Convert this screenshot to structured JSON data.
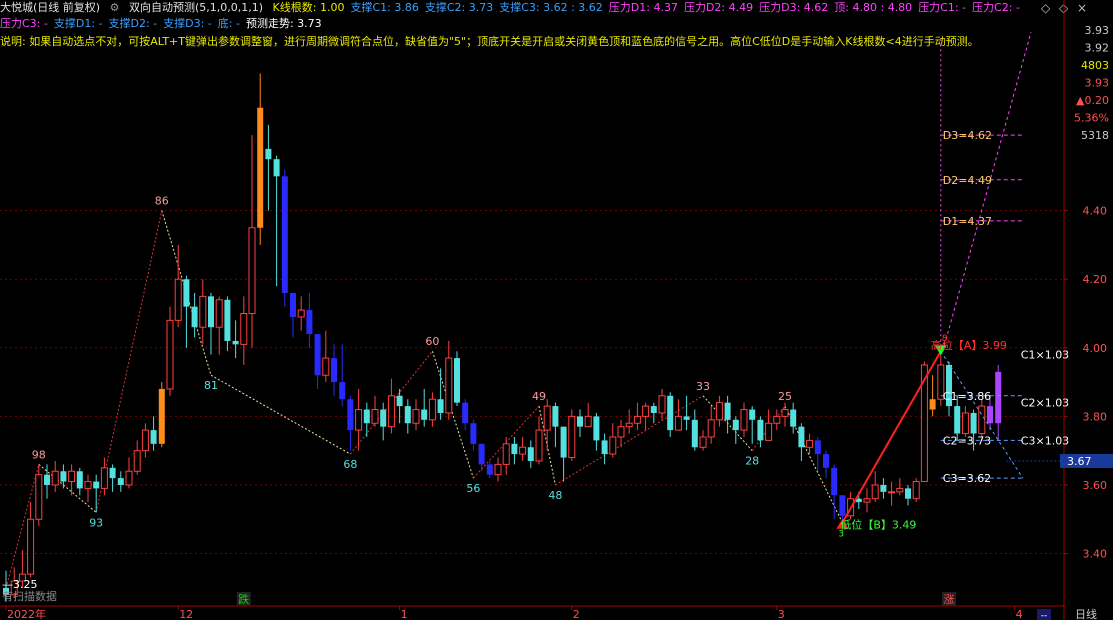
{
  "header": {
    "title": "大悦城(日线 前复权)",
    "indicator": "双向自动预测(5,1,0,0,1,1)",
    "line1": [
      {
        "label": "K线根数: 1.00",
        "color": "#e8e800"
      },
      {
        "label": "支撑C1: 3.86",
        "color": "#3aa0ff"
      },
      {
        "label": "支撑C2: 3.73",
        "color": "#3aa0ff"
      },
      {
        "label": "支撑C3: 3.62 : 3.62",
        "color": "#3aa0ff"
      },
      {
        "label": "压力D1: 4.37",
        "color": "#ff44ff"
      },
      {
        "label": "压力D2: 4.49",
        "color": "#ff44ff"
      },
      {
        "label": "压力D3: 4.62",
        "color": "#ff44ff"
      },
      {
        "label": "顶: 4.80 : 4.80",
        "color": "#ff44ff"
      },
      {
        "label": "压力C1: -",
        "color": "#ff44ff"
      },
      {
        "label": "压力C2: -",
        "color": "#ff44ff"
      }
    ],
    "line2": [
      {
        "label": "压力C3: -",
        "color": "#ff44ff"
      },
      {
        "label": "支撑D1: -",
        "color": "#3aa0ff"
      },
      {
        "label": "支撑D2: -",
        "color": "#3aa0ff"
      },
      {
        "label": "支撑D3: -",
        "color": "#3aa0ff"
      },
      {
        "label": "底: -",
        "color": "#3aa0ff"
      },
      {
        "label": "预测走势: 3.73",
        "color": "#ffffff"
      }
    ],
    "note": "说明: 如果自动选点不对，可按ALT+T键弹出参数调整窗，进行周期微调符合点位，缺省值为\"5\"；顶底开关是开启或关闭黄色顶和蓝色底的信号之用。高位C低位D是手动输入K线根数<4进行手动预测。",
    "controls": [
      "◇",
      "◇",
      "×"
    ]
  },
  "chart_data": {
    "type": "candlestick",
    "ylim": [
      3.25,
      4.95
    ],
    "yticks": [
      3.4,
      3.6,
      3.8,
      4.0,
      4.2,
      4.4
    ],
    "ytick_labels": [
      "3.40",
      "3.60",
      "3.80",
      "4.00",
      "4.20",
      "4.40"
    ],
    "xlabels": [
      {
        "label": "2022年",
        "bar": 0
      },
      {
        "label": "12",
        "bar": 21
      },
      {
        "label": "1",
        "bar": 48
      },
      {
        "label": "2",
        "bar": 69
      },
      {
        "label": "3",
        "bar": 94
      },
      {
        "label": "4",
        "bar": 123
      }
    ],
    "sidebar_values": [
      {
        "text": "3.93",
        "color": "#cccccc"
      },
      {
        "text": "3.92",
        "color": "#cccccc"
      },
      {
        "text": "4803",
        "color": "#e8e800"
      },
      {
        "text": "3.93",
        "color": "#ff5050"
      },
      {
        "text": "▲0.20",
        "color": "#ff5050"
      },
      {
        "text": "5.36%",
        "color": "#ff5050"
      },
      {
        "text": "5318",
        "color": "#cccccc"
      }
    ],
    "current_price": "3.67",
    "period_label": "日线",
    "bottom_marks": [
      {
        "text": "跌",
        "bar": 29,
        "color": "#00dd00"
      },
      {
        "text": "涨",
        "bar": 115,
        "color": "#ff5050"
      }
    ],
    "corner_text": "有扫描数据",
    "start_label": "—3.25",
    "candles": [
      [
        3.3,
        3.28,
        3.35,
        3.26
      ],
      [
        3.28,
        3.32,
        3.36,
        3.27
      ],
      [
        3.32,
        3.34,
        3.41,
        3.3
      ],
      [
        3.34,
        3.5,
        3.55,
        3.33
      ],
      [
        3.5,
        3.63,
        3.66,
        3.48
      ],
      [
        3.63,
        3.6,
        3.66,
        3.56
      ],
      [
        3.6,
        3.64,
        3.67,
        3.58
      ],
      [
        3.64,
        3.61,
        3.66,
        3.59
      ],
      [
        3.61,
        3.64,
        3.66,
        3.57
      ],
      [
        3.64,
        3.59,
        3.65,
        3.57
      ],
      [
        3.59,
        3.61,
        3.63,
        3.55
      ],
      [
        3.61,
        3.59,
        3.63,
        3.52
      ],
      [
        3.59,
        3.65,
        3.68,
        3.57
      ],
      [
        3.65,
        3.62,
        3.66,
        3.58
      ],
      [
        3.62,
        3.6,
        3.64,
        3.58
      ],
      [
        3.6,
        3.64,
        3.68,
        3.59
      ],
      [
        3.64,
        3.7,
        3.73,
        3.63
      ],
      [
        3.7,
        3.76,
        3.78,
        3.68
      ],
      [
        3.76,
        3.72,
        3.8,
        3.7
      ],
      [
        3.72,
        3.88,
        3.9,
        3.71
      ],
      [
        3.88,
        4.08,
        4.12,
        3.86
      ],
      [
        4.08,
        4.2,
        4.3,
        4.06
      ],
      [
        4.2,
        4.12,
        4.21,
        4.0
      ],
      [
        4.12,
        4.06,
        4.16,
        4.03
      ],
      [
        4.06,
        4.15,
        4.2,
        4.01
      ],
      [
        4.15,
        4.06,
        4.16,
        3.98
      ],
      [
        4.06,
        4.14,
        4.15,
        3.98
      ],
      [
        4.14,
        4.02,
        4.15,
        3.99
      ],
      [
        4.02,
        4.01,
        4.08,
        3.97
      ],
      [
        4.01,
        4.1,
        4.15,
        3.95
      ],
      [
        4.1,
        4.35,
        4.62,
        4.0
      ],
      [
        4.35,
        4.7,
        4.8,
        4.3
      ],
      [
        4.58,
        4.55,
        4.65,
        4.4
      ],
      [
        4.55,
        4.5,
        4.56,
        4.18
      ],
      [
        4.5,
        4.16,
        4.52,
        4.12
      ],
      [
        4.16,
        4.09,
        4.13,
        4.03
      ],
      [
        4.09,
        4.11,
        4.15,
        4.05
      ],
      [
        4.11,
        4.04,
        4.16,
        4.0
      ],
      [
        4.04,
        3.92,
        4.04,
        3.88
      ],
      [
        3.92,
        3.97,
        4.05,
        3.9
      ],
      [
        3.97,
        3.9,
        4.01,
        3.86
      ],
      [
        3.9,
        3.85,
        4.01,
        3.83
      ],
      [
        3.85,
        3.76,
        3.86,
        3.7
      ],
      [
        3.76,
        3.82,
        3.88,
        3.7
      ],
      [
        3.82,
        3.78,
        3.84,
        3.74
      ],
      [
        3.78,
        3.82,
        3.86,
        3.77
      ],
      [
        3.82,
        3.77,
        3.84,
        3.73
      ],
      [
        3.77,
        3.86,
        3.91,
        3.75
      ],
      [
        3.86,
        3.83,
        3.88,
        3.78
      ],
      [
        3.83,
        3.78,
        3.85,
        3.75
      ],
      [
        3.78,
        3.82,
        3.85,
        3.76
      ],
      [
        3.82,
        3.79,
        3.88,
        3.77
      ],
      [
        3.79,
        3.85,
        3.87,
        3.77
      ],
      [
        3.85,
        3.81,
        3.94,
        3.79
      ],
      [
        3.81,
        3.97,
        4.02,
        3.79
      ],
      [
        3.97,
        3.84,
        3.99,
        3.83
      ],
      [
        3.84,
        3.78,
        3.85,
        3.76
      ],
      [
        3.78,
        3.72,
        3.79,
        3.7
      ],
      [
        3.72,
        3.66,
        3.72,
        3.64
      ],
      [
        3.66,
        3.63,
        3.67,
        3.62
      ],
      [
        3.63,
        3.66,
        3.68,
        3.61
      ],
      [
        3.66,
        3.72,
        3.74,
        3.63
      ],
      [
        3.72,
        3.69,
        3.74,
        3.66
      ],
      [
        3.69,
        3.71,
        3.74,
        3.67
      ],
      [
        3.71,
        3.67,
        3.73,
        3.65
      ],
      [
        3.67,
        3.76,
        3.8,
        3.66
      ],
      [
        3.76,
        3.83,
        3.85,
        3.7
      ],
      [
        3.83,
        3.77,
        3.84,
        3.71
      ],
      [
        3.77,
        3.68,
        3.77,
        3.61
      ],
      [
        3.68,
        3.8,
        3.82,
        3.67
      ],
      [
        3.8,
        3.77,
        3.82,
        3.74
      ],
      [
        3.77,
        3.8,
        3.84,
        3.77
      ],
      [
        3.8,
        3.73,
        3.81,
        3.7
      ],
      [
        3.73,
        3.69,
        3.75,
        3.66
      ],
      [
        3.69,
        3.74,
        3.78,
        3.68
      ],
      [
        3.74,
        3.77,
        3.79,
        3.71
      ],
      [
        3.77,
        3.78,
        3.82,
        3.75
      ],
      [
        3.78,
        3.8,
        3.84,
        3.76
      ],
      [
        3.8,
        3.83,
        3.84,
        3.76
      ],
      [
        3.83,
        3.81,
        3.84,
        3.78
      ],
      [
        3.81,
        3.86,
        3.88,
        3.79
      ],
      [
        3.86,
        3.76,
        3.87,
        3.74
      ],
      [
        3.76,
        3.8,
        3.85,
        3.77
      ],
      [
        3.8,
        3.79,
        3.86,
        3.76
      ],
      [
        3.79,
        3.71,
        3.82,
        3.7
      ],
      [
        3.71,
        3.74,
        3.76,
        3.7
      ],
      [
        3.74,
        3.79,
        3.83,
        3.72
      ],
      [
        3.79,
        3.84,
        3.86,
        3.77
      ],
      [
        3.84,
        3.79,
        3.86,
        3.75
      ],
      [
        3.79,
        3.76,
        3.8,
        3.72
      ],
      [
        3.76,
        3.82,
        3.84,
        3.74
      ],
      [
        3.82,
        3.79,
        3.83,
        3.72
      ],
      [
        3.79,
        3.73,
        3.8,
        3.71
      ],
      [
        3.73,
        3.78,
        3.82,
        3.75
      ],
      [
        3.78,
        3.8,
        3.82,
        3.76
      ],
      [
        3.8,
        3.82,
        3.84,
        3.77
      ],
      [
        3.82,
        3.77,
        3.84,
        3.75
      ],
      [
        3.77,
        3.71,
        3.78,
        3.67
      ],
      [
        3.71,
        3.73,
        3.75,
        3.69
      ],
      [
        3.73,
        3.69,
        3.74,
        3.64
      ],
      [
        3.69,
        3.65,
        3.7,
        3.62
      ],
      [
        3.65,
        3.57,
        3.66,
        3.5
      ],
      [
        3.57,
        3.51,
        3.57,
        3.49
      ],
      [
        3.51,
        3.56,
        3.58,
        3.5
      ],
      [
        3.56,
        3.55,
        3.58,
        3.53
      ],
      [
        3.55,
        3.56,
        3.59,
        3.52
      ],
      [
        3.56,
        3.6,
        3.64,
        3.55
      ],
      [
        3.6,
        3.58,
        3.62,
        3.56
      ],
      [
        3.58,
        3.58,
        3.61,
        3.54
      ],
      [
        3.58,
        3.59,
        3.62,
        3.57
      ],
      [
        3.59,
        3.56,
        3.6,
        3.54
      ],
      [
        3.56,
        3.61,
        3.62,
        3.55
      ],
      [
        3.61,
        3.95,
        3.96,
        3.61
      ],
      [
        3.82,
        3.85,
        3.92,
        3.8
      ],
      [
        3.85,
        3.95,
        3.98,
        3.83
      ],
      [
        3.95,
        3.83,
        3.96,
        3.8
      ],
      [
        3.83,
        3.75,
        3.86,
        3.73
      ],
      [
        3.75,
        3.81,
        3.83,
        3.74
      ],
      [
        3.81,
        3.75,
        3.82,
        3.7
      ],
      [
        3.75,
        3.83,
        3.85,
        3.74
      ],
      [
        3.83,
        3.78,
        3.86,
        3.76
      ],
      [
        3.78,
        3.93,
        3.95,
        3.73
      ]
    ],
    "swing_labels": [
      {
        "text": "98",
        "bar": 4,
        "price": 3.66,
        "pos": "above"
      },
      {
        "text": "93",
        "bar": 11,
        "price": 3.52,
        "pos": "below"
      },
      {
        "text": "86",
        "bar": 19,
        "price": 4.4,
        "pos": "above"
      },
      {
        "text": "81",
        "bar": 25,
        "price": 3.92,
        "pos": "below"
      },
      {
        "text": "68",
        "bar": 42,
        "price": 3.69,
        "pos": "below"
      },
      {
        "text": "60",
        "bar": 52,
        "price": 3.99,
        "pos": "above"
      },
      {
        "text": "56",
        "bar": 57,
        "price": 3.62,
        "pos": "below"
      },
      {
        "text": "49",
        "bar": 65,
        "price": 3.83,
        "pos": "above"
      },
      {
        "text": "48",
        "bar": 67,
        "price": 3.6,
        "pos": "below"
      },
      {
        "text": "33",
        "bar": 85,
        "price": 3.86,
        "pos": "above"
      },
      {
        "text": "28",
        "bar": 91,
        "price": 3.7,
        "pos": "below"
      },
      {
        "text": "25",
        "bar": 95,
        "price": 3.83,
        "pos": "above"
      }
    ],
    "levels": [
      {
        "text": "D3=4.62",
        "value": 4.62
      },
      {
        "text": "D2=4.49",
        "value": 4.49
      },
      {
        "text": "D1=4.37",
        "value": 4.37
      },
      {
        "text": "C1=3.86",
        "value": 3.86
      },
      {
        "text": "C2=3.73",
        "value": 3.73
      },
      {
        "text": "C3=3.62",
        "value": 3.62
      }
    ],
    "right_labels": [
      {
        "text": "C1×1.03",
        "value": 3.98
      },
      {
        "text": "C2×1.03",
        "value": 3.84
      },
      {
        "text": "C3×1.03",
        "value": 3.73
      }
    ],
    "high_label": "高位【A】3.99",
    "low_label": "低位【B】3.49",
    "high_small": "8",
    "low_small": "3"
  }
}
